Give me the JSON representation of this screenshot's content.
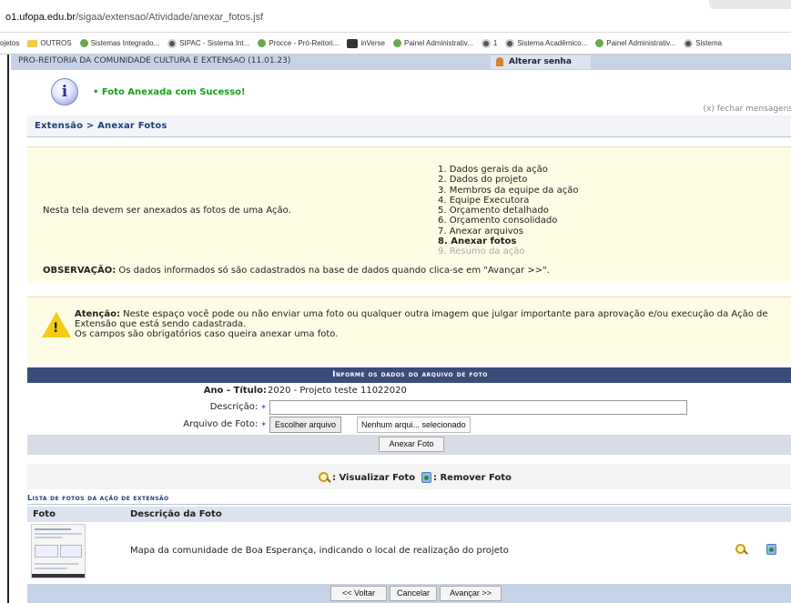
{
  "browser": {
    "url_host": "o1.ufopa.edu.br",
    "url_path": "/sigaa/extensao/Atividade/anexar_fotos.jsf",
    "bookmarks": [
      {
        "label": "ojetos",
        "icon": "none"
      },
      {
        "label": "OUTROS",
        "icon": "folder-icon"
      },
      {
        "label": "Sistemas Integrado...",
        "icon": "site-icon"
      },
      {
        "label": "SIPAC - Sistema Int...",
        "icon": "globe-icon"
      },
      {
        "label": "Procce - Pró-Reitori...",
        "icon": "site-icon"
      },
      {
        "label": "inVerse",
        "icon": "app-icon"
      },
      {
        "label": "Painel Administrativ...",
        "icon": "site-icon"
      },
      {
        "label": "1",
        "icon": "globe-icon"
      },
      {
        "label": "Sistema Acadêmico...",
        "icon": "globe-icon"
      },
      {
        "label": "Painel Administrativ...",
        "icon": "site-icon"
      },
      {
        "label": "Sistema",
        "icon": "globe-icon"
      }
    ]
  },
  "header": {
    "unit": "PRO-REITORIA DA COMUNIDADE CULTURA E EXTENSAO (11.01.23)",
    "change_password": "Alterar senha"
  },
  "message": {
    "text": "• Foto Anexada com Sucesso!",
    "close": "(x) fechar mensagens"
  },
  "breadcrumb": "Extensão > Anexar Fotos",
  "intro": {
    "description": "Nesta tela devem ser anexados as fotos de uma Ação.",
    "steps": [
      "1. Dados gerais da ação",
      "2. Dados do projeto",
      "3. Membros da equipe da ação",
      "4. Equipe Executora",
      "5. Orçamento detalhado",
      "6. Orçamento consolidado",
      "7. Anexar arquivos",
      "8. Anexar fotos",
      "9. Resumo da ação"
    ],
    "current_step": 8,
    "obs_label": "OBSERVAÇÃO:",
    "obs_text": " Os dados informados só são cadastrados na base de dados quando clica-se em \"Avançar >>\"."
  },
  "attention": {
    "label": "Atenção:",
    "text_line1": " Neste espaço você pode ou não enviar uma foto ou qualquer outra imagem que julgar importante para aprovação e/ou execução da Ação de Extensão que está sendo cadastrada.",
    "text_line2": "Os campos são obrigatórios caso queira anexar uma foto."
  },
  "form": {
    "title": "Informe os dados do arquivo de foto",
    "ano_titulo_label": "Ano - Título:",
    "ano_titulo_value": "2020 - Projeto teste 11022020",
    "descricao_label": "Descrição:",
    "descricao_value": "",
    "arquivo_label": "Arquivo de Foto:",
    "choose_file": "Escolher arquivo",
    "no_file": "Nenhum arqui... selecionado",
    "submit": "Anexar Foto"
  },
  "legend": {
    "view": ": Visualizar Foto",
    "remove": ": Remover Foto"
  },
  "list": {
    "title": "Lista de fotos da ação de extensão",
    "col_photo": "Foto",
    "col_desc": "Descrição da Foto",
    "rows": [
      {
        "description": "Mapa da comunidade de Boa Esperança, indicando o local de realização do projeto"
      }
    ]
  },
  "nav": {
    "back": "<< Voltar",
    "cancel": "Cancelar",
    "next": "Avançar >>"
  }
}
